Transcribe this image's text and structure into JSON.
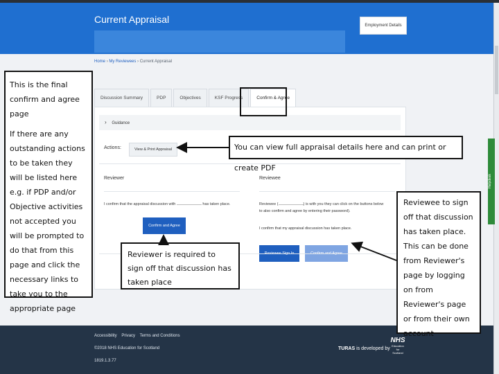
{
  "header": {
    "title": "Current Appraisal",
    "employment_details_label": "Employment Details"
  },
  "breadcrumb": {
    "home": "Home",
    "my_reviewees": "My Reviewees",
    "current": "Current Appraisal",
    "separator": "›"
  },
  "tabs": [
    {
      "label": "Discussion Summary"
    },
    {
      "label": "PDP"
    },
    {
      "label": "Objectives"
    },
    {
      "label": "KSF Progress"
    },
    {
      "label": "Confirm & Agree"
    }
  ],
  "guidance": {
    "label": "Guidance",
    "icon": "chevron-right-icon"
  },
  "actions": {
    "label": "Actions:",
    "view_print_label": "View & Print Appraisal"
  },
  "reviewer": {
    "title": "Reviewer",
    "confirm_text_prefix": "I confirm that the appraisal discussion with",
    "confirm_text_suffix": "has taken place.",
    "confirm_button": "Confirm and Agree"
  },
  "reviewee": {
    "title": "Reviewee",
    "text_line1_prefix": "Reviewee (",
    "text_line1_suffix": ") is with you they can click on the buttons below",
    "text_line2": "to also confirm and agree by entering their password).",
    "confirm_text": "I confirm that my appraisal discussion has taken place.",
    "sign_in_button": "Reviewee Sign In",
    "confirm_button": "Confirm and Agree"
  },
  "helpdesk": {
    "label": "Helpdesk"
  },
  "footer": {
    "links": [
      "Accessibility",
      "Privacy",
      "Terms and Conditions"
    ],
    "copyright": "©2018 NHS Education for Scotland",
    "version": "1819.1.3.77",
    "turas_bold": "TURAS",
    "turas_rest": " is developed by",
    "nhs_label": "NHS",
    "nhs_sub1": "Education",
    "nhs_sub2": "for",
    "nhs_sub3": "Scotland"
  },
  "annotations": {
    "left_p1": "This is the final confirm and agree page",
    "left_p2": "If there are any outstanding actions to be taken they will be listed here e.g. if PDP and/or Objective activities not accepted you will be prompted to do that from this page and click the necessary links to take you to the appropriate page",
    "top": "You can view full appraisal details here and can print or create PDF",
    "middle": "Reviewer is required to sign off that discussion has taken place",
    "right": "Reviewee to sign off that discussion has taken place. This can be done from Reviewer's page by logging on from Reviewer's page or from their own account"
  },
  "colors": {
    "header_blue": "#1f6fd0",
    "button_blue": "#1f5fbf",
    "button_light_blue": "#7fa5e2",
    "footer_navy": "#243447",
    "helpdesk_green": "#2e8b3a"
  }
}
